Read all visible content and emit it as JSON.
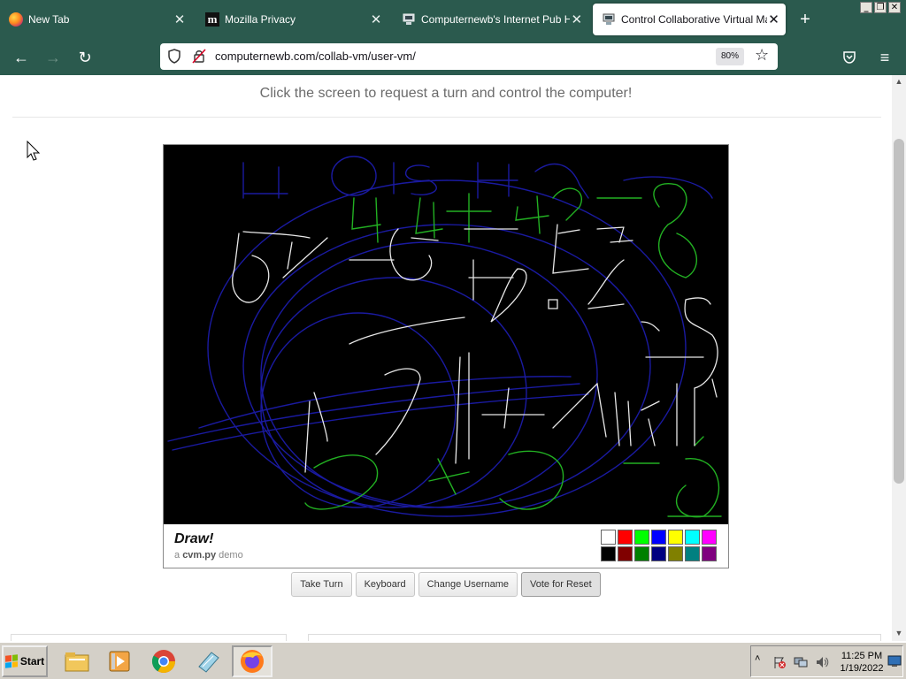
{
  "window": {
    "minimize": "_",
    "restore": "❐",
    "close": "✕"
  },
  "tabs": [
    {
      "title": "New Tab",
      "icon": "firefox-icon",
      "active": false
    },
    {
      "title": "Mozilla Privacy",
      "icon": "mozilla-m-icon",
      "active": false
    },
    {
      "title": "Computernewb's Internet Pub Hub",
      "icon": "computer-icon",
      "active": false
    },
    {
      "title": "Control Collaborative Virtual Machine",
      "icon": "computer-icon",
      "active": true
    }
  ],
  "tab_close": "✕",
  "new_tab": "+",
  "nav": {
    "back": "←",
    "forward": "→",
    "reload": "↻",
    "url": "computernewb.com/collab-vm/user-vm/",
    "zoom": "80%",
    "star": "☆",
    "menu": "≡"
  },
  "page": {
    "instruction": "Click the screen to request a turn and control the computer!",
    "draw_title": "Draw!",
    "draw_sub_prefix": "a ",
    "draw_sub_bold": "cvm.py",
    "draw_sub_suffix": " demo",
    "palette": [
      "#ffffff",
      "#ff0000",
      "#00ff00",
      "#0000ff",
      "#ffff00",
      "#00ffff",
      "#ff00ff",
      "#000000",
      "#800000",
      "#008000",
      "#000080",
      "#808000",
      "#008080",
      "#800080"
    ],
    "buttons": [
      "Take Turn",
      "Keyboard",
      "Change Username",
      "Vote for Reset"
    ]
  },
  "taskbar": {
    "start": "Start",
    "apps": [
      "file-explorer-icon",
      "media-player-icon",
      "chrome-icon",
      "notepad-icon",
      "firefox-icon"
    ],
    "tray_chevron": "˄",
    "time": "11:25 PM",
    "date": "1/19/2022"
  }
}
